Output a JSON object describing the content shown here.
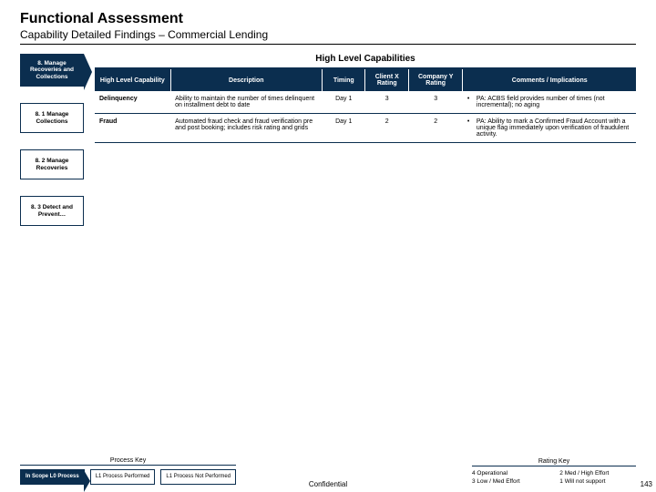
{
  "header": {
    "title": "Functional Assessment",
    "subtitle": "Capability Detailed Findings – Commercial Lending"
  },
  "nav": {
    "current": "8. Manage Recoveries and Collections",
    "subs": [
      "8. 1 Manage Collections",
      "8. 2 Manage Recoveries",
      "8. 3 Detect and Prevent…"
    ]
  },
  "panel": {
    "title": "High Level Capabilities"
  },
  "columns": {
    "hlc": "High Level Capability",
    "desc": "Description",
    "timing": "Timing",
    "rx": "Client X Rating",
    "ry": "Company Y Rating",
    "comm": "Comments / Implications"
  },
  "rows": [
    {
      "hlc": "Delinquency",
      "desc": "Ability to maintain the number of times delinquent on installment debt to date",
      "timing": "Day 1",
      "rx": "3",
      "ry": "3",
      "comm": "PA: ACBS field provides number of times (not incremental); no aging"
    },
    {
      "hlc": "Fraud",
      "desc": "Automated fraud check and fraud verification pre and post booking; includes risk rating and grids",
      "timing": "Day 1",
      "rx": "2",
      "ry": "2",
      "comm": "PA: Ability to mark a Confirmed Fraud Account with a unique flag immediately upon verification of fraudulent activity."
    }
  ],
  "processKey": {
    "title": "Process Key",
    "items": [
      "In Scope L0 Process",
      "L1 Process Performed",
      "L1 Process Not Performed"
    ]
  },
  "ratingKey": {
    "title": "Rating Key",
    "items": [
      "4 Operational",
      "2 Med / High Effort",
      "3 Low / Med Effort",
      "1 Will not support"
    ]
  },
  "footer": {
    "confidential": "Confidential",
    "page": "143"
  }
}
